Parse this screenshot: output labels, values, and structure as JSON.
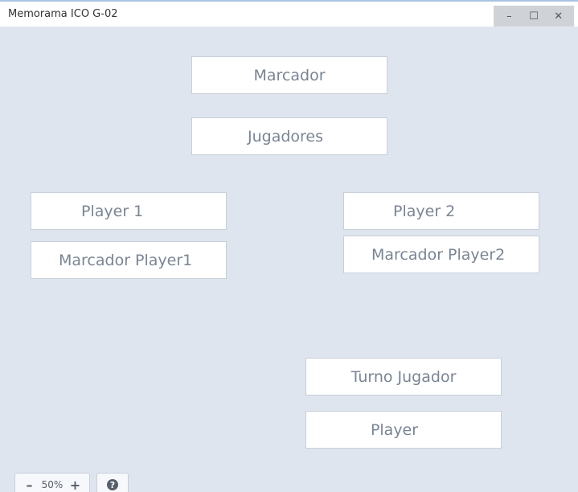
{
  "window": {
    "title": "Memorama ICO G-02",
    "controls": {
      "minimize": "–",
      "maximize": "☐",
      "close": "✕"
    }
  },
  "labels": {
    "marcador": "Marcador",
    "jugadores": "Jugadores",
    "player1": "Player 1",
    "player2": "Player 2",
    "marcador_player1": "Marcador Player1",
    "marcador_player2": "Marcador Player2",
    "turno_jugador": "Turno Jugador",
    "player": "Player"
  },
  "zoom": {
    "minus": "–",
    "level": "50%",
    "plus": "+"
  },
  "help": {
    "symbol": "?"
  },
  "colors": {
    "background": "#dfe5ee",
    "box_text": "#7a8593",
    "box_border": "#c9cfd8"
  }
}
